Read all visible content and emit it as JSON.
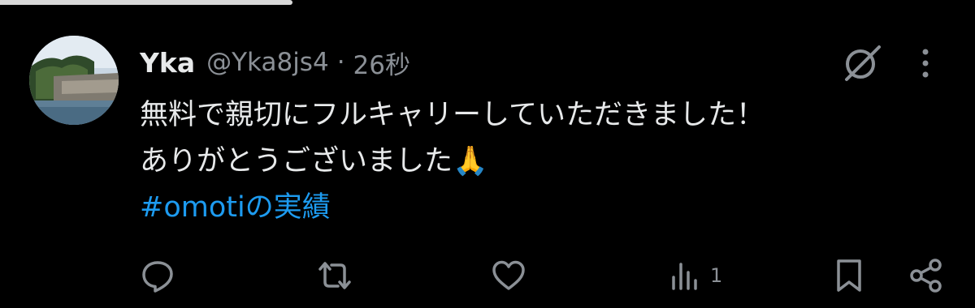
{
  "status": {
    "progress": 0.3
  },
  "tweet": {
    "display_name": "Yka",
    "handle": "@Yka8js4",
    "separator": "·",
    "timestamp": "26秒",
    "lines": [
      "無料で親切にフルキャリーしていただきました！",
      "ありがとうございました🙏"
    ],
    "hashtag": "#omotiの実績"
  },
  "actions": {
    "reply_icon": "reply-icon",
    "retweet_icon": "retweet-icon",
    "like_icon": "heart-icon",
    "views_icon": "views-icon",
    "views_count": "1",
    "bookmark_icon": "bookmark-icon",
    "share_icon": "share-icon"
  },
  "colors": {
    "background": "#000000",
    "text": "#e7e9ea",
    "muted": "#8b9096",
    "link": "#1d9bf0"
  }
}
